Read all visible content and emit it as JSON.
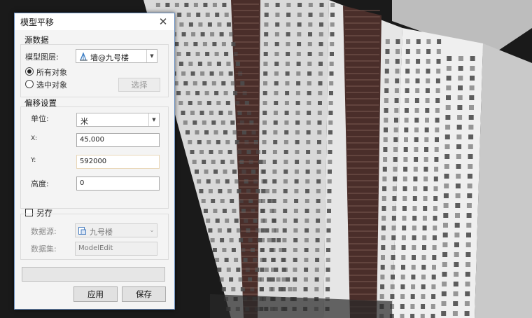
{
  "dialog": {
    "title": "模型平移",
    "close_glyph": "✕",
    "source": {
      "group_title": "源数据",
      "layer_label": "模型图层:",
      "layer_value": "墙@九号楼",
      "layer_icon": "building-layer-icon",
      "all_objects_label": "所有对象",
      "selected_objects_label": "选中对象",
      "selected_mode": "all",
      "select_button": "选择"
    },
    "offset": {
      "group_title": "偏移设置",
      "unit_label": "单位:",
      "unit_value": "米",
      "x_label": "X:",
      "x_value": "45,000",
      "y_label": "Y:",
      "y_value": "592000",
      "height_label": "高度:",
      "height_value": "0"
    },
    "save_as": {
      "checkbox_label": "另存",
      "checked": false,
      "datasource_label": "数据源:",
      "datasource_value": "九号楼",
      "datasource_icon": "database-icon",
      "dataset_label": "数据集:",
      "dataset_value": "ModelEdit"
    },
    "progress": 0,
    "apply_button": "应用",
    "save_button": "保存"
  },
  "scene": {
    "wall_color": "#e4e4e4",
    "shadow_color": "#b9b9b9",
    "window_color": "#4d4d4d",
    "brick_color": "#4a2e2a",
    "background": "#1a1a1a"
  }
}
